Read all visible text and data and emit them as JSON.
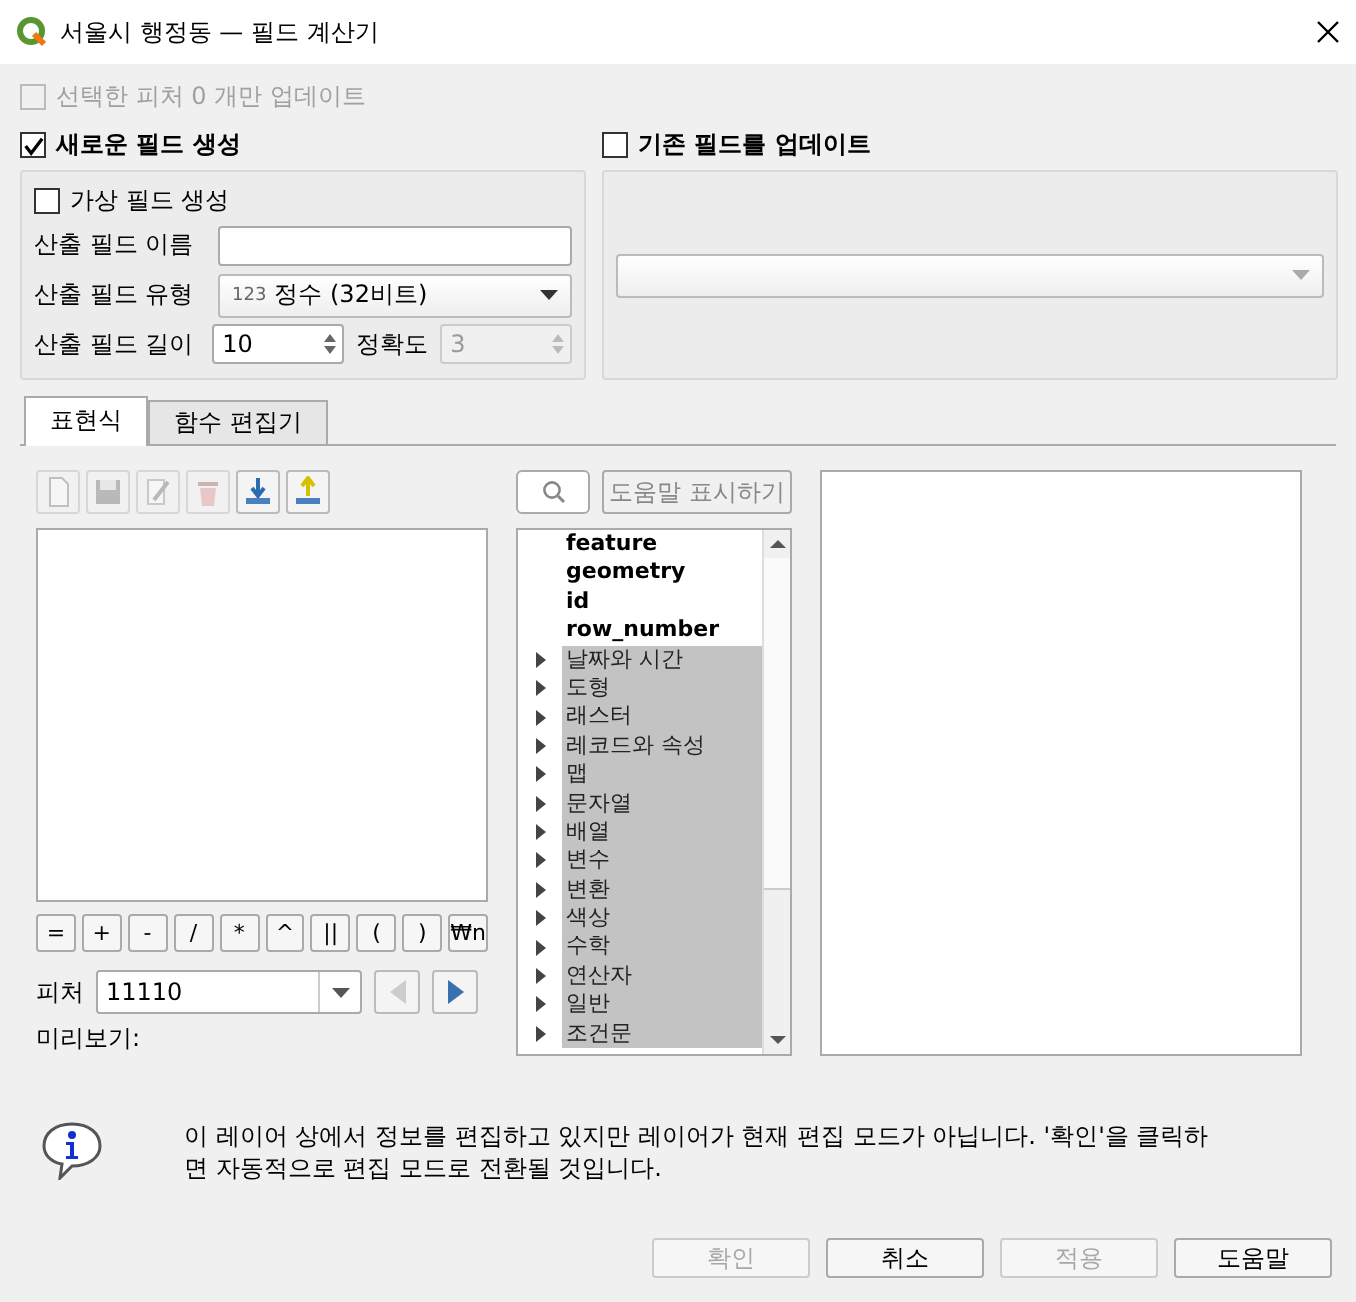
{
  "window": {
    "title": "서울시 행정동 — 필드 계산기"
  },
  "update_selected": {
    "label": "선택한 피처 0 개만 업데이트",
    "checked": false,
    "disabled": true
  },
  "new_field": {
    "label": "새로운 필드 생성",
    "checked": true,
    "virtual": {
      "label": "가상 필드 생성",
      "checked": false
    },
    "name": {
      "label": "산출 필드 이름"
    },
    "type": {
      "label": "산출 필드 유형",
      "badge": "123",
      "value": "정수 (32비트)"
    },
    "length": {
      "label": "산출 필드 길이",
      "value": "10"
    },
    "precision": {
      "label": "정확도",
      "value": "3",
      "disabled": true
    }
  },
  "update_existing": {
    "label": "기존 필드를 업데이트",
    "checked": false
  },
  "tabs": [
    {
      "label": "표현식",
      "selected": true
    },
    {
      "label": "함수 편집기",
      "selected": false
    }
  ],
  "toolbar": [
    {
      "kind": "new",
      "disabled": true
    },
    {
      "kind": "save",
      "disabled": true
    },
    {
      "kind": "edit",
      "disabled": true
    },
    {
      "kind": "delete",
      "disabled": true
    },
    {
      "kind": "import",
      "disabled": false
    },
    {
      "kind": "export",
      "disabled": false
    }
  ],
  "operators": [
    "=",
    "+",
    "-",
    "/",
    "*",
    "^",
    "||",
    "(",
    ")",
    "₩n"
  ],
  "feature": {
    "label": "피처",
    "value": "11110"
  },
  "preview_label": "미리보기:",
  "help_button": "도움말 표시하기",
  "functions": [
    {
      "label": "feature",
      "kind": "field"
    },
    {
      "label": "geometry",
      "kind": "field"
    },
    {
      "label": "id",
      "kind": "field"
    },
    {
      "label": "row_number",
      "kind": "field"
    },
    {
      "label": "날짜와 시간",
      "kind": "group"
    },
    {
      "label": "도형",
      "kind": "group"
    },
    {
      "label": "래스터",
      "kind": "group"
    },
    {
      "label": "레코드와 속성",
      "kind": "group"
    },
    {
      "label": "맵",
      "kind": "group"
    },
    {
      "label": "문자열",
      "kind": "group"
    },
    {
      "label": "배열",
      "kind": "group"
    },
    {
      "label": "변수",
      "kind": "group"
    },
    {
      "label": "변환",
      "kind": "group"
    },
    {
      "label": "색상",
      "kind": "group"
    },
    {
      "label": "수학",
      "kind": "group"
    },
    {
      "label": "연산자",
      "kind": "group"
    },
    {
      "label": "일반",
      "kind": "group"
    },
    {
      "label": "조건문",
      "kind": "group"
    }
  ],
  "message": "이 레이어 상에서 정보를 편집하고 있지만 레이어가 현재 편집 모드가 아닙니다. '확인'을 클릭하면 자동적으로 편집 모드로 전환될 것입니다.",
  "buttons": [
    {
      "label": "확인",
      "disabled": true
    },
    {
      "label": "취소",
      "disabled": false
    },
    {
      "label": "적용",
      "disabled": true
    },
    {
      "label": "도움말",
      "disabled": false
    }
  ]
}
